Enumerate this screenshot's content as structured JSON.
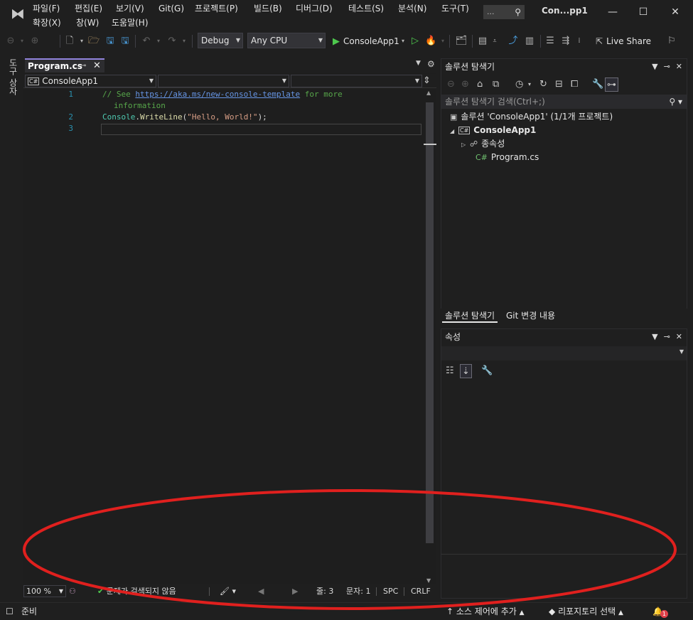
{
  "menu": {
    "row1": [
      "파일(F)",
      "편집(E)",
      "보기(V)",
      "Git(G)",
      "프로젝트(P)",
      "빌드(B)",
      "디버그(D)",
      "테스트(S)",
      "분석(N)",
      "도구(T)"
    ],
    "row2": [
      "확장(X)",
      "창(W)",
      "도움말(H)"
    ],
    "search_placeholder": "...",
    "window_title": "Con...pp1"
  },
  "toolbar": {
    "config": "Debug",
    "platform": "Any CPU",
    "run_target": "ConsoleApp1",
    "live_share": "Live Share"
  },
  "left_strip": {
    "tab_label": "도구 상자"
  },
  "editor": {
    "tab_label": "Program.cs",
    "project_combo": "ConsoleApp1",
    "lines": [
      {
        "num": "1",
        "comment_prefix": "// See ",
        "link": "https://aka.ms/new-console-template",
        "comment_suffix": " for more",
        "wrap": "information"
      },
      {
        "num": "2",
        "ident": "Console",
        "dot": ".",
        "method": "WriteLine",
        "open": "(",
        "string": "\"Hello, World!\"",
        "close": ");"
      },
      {
        "num": "3"
      }
    ],
    "status": {
      "zoom": "100 %",
      "issues": "문제가 검색되지 않음",
      "line": "줄: 3",
      "col": "문자: 1",
      "spc": "SPC",
      "crlf": "CRLF"
    }
  },
  "solution_explorer": {
    "title": "솔루션 탐색기",
    "search_placeholder": "솔루션 탐색기 검색(Ctrl+;)",
    "tree": [
      {
        "label": "솔루션 'ConsoleApp1' (1/1개 프로젝트)"
      },
      {
        "label": "ConsoleApp1"
      },
      {
        "label": "종속성"
      },
      {
        "label": "Program.cs"
      }
    ],
    "tabs": [
      "솔루션 탐색기",
      "Git 변경 내용"
    ]
  },
  "properties": {
    "title": "속성"
  },
  "statusbar": {
    "ready": "준비",
    "add_source_control": "소스 제어에 추가",
    "select_repo": "리포지토리 선택",
    "notification_count": "1"
  },
  "colors": {
    "accent_tab": "#9184dd",
    "annotation": "#e0201e",
    "run_green": "#4ec94e"
  },
  "icons": [
    "search-icon",
    "save-icon",
    "undo-icon",
    "redo-icon",
    "play-icon",
    "gear-icon",
    "pin-icon",
    "close-icon",
    "home-icon",
    "refresh-icon",
    "wrench-icon",
    "bell-icon",
    "git-icon"
  ]
}
